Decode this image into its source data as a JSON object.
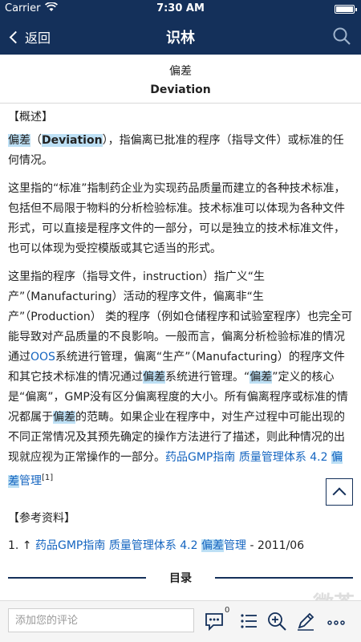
{
  "status": {
    "carrier": "Carrier",
    "time": "7:30 AM"
  },
  "nav": {
    "back_label": "返回",
    "title": "识林"
  },
  "article": {
    "title": "偏差",
    "subtitle": "Deviation",
    "overview_head": "【概述】",
    "p1": {
      "t1": "偏差",
      "t2": "（",
      "t3": "Deviation",
      "t4": "），指偏离已批准的程序（指导文件）或标准的任何情况。"
    },
    "p2": "这里指的“标准”指制药企业为实现药品质量而建立的各种技术标准，包括但不局限于物料的分析检验标准。技术标准可以体现为各种文件形式，可以直接是程序文件的一部分，可以是独立的技术标准文件，也可以体现为受控模版或其它适当的形式。",
    "p3": {
      "s1": "这里指的程序（指导文件，instruction）指广义“生产”（Manufacturing）活动的程序文件，偏离非“生产”（Production） 类的程序（例如仓储程序和试验室程序）也完全可能导致对产品质量的不良影响。一般而言，偏离分析检验标准的情况通过",
      "oos": "OOS",
      "s2": "系统进行管理，偏离“生产”（Manufacturing）的程序文件和其它技术标准的情况通过",
      "hl1": "偏差",
      "s3": "系统进行管理。“",
      "hl2": "偏差",
      "s4": "”定义的核心是“偏离”，GMP没有区分偏离程度的大小。所有偏离程序或标准的情况都属于",
      "hl3": "偏差",
      "s5": "的范畴。如果企业在程序中，对生产过程中可能出现的不同正常情况及其预先确定的操作方法进行了描述，则此种情况的出现就应视为正常操作的一部分。",
      "link_a": "药品GMP指南 质量管理体系 4.2 ",
      "link_hl": "偏差",
      "link_b": "管理",
      "sup": "[1]"
    },
    "refs_head": "【参考资料】",
    "ref1": {
      "num": "1. ↑ ",
      "link_a": "药品GMP指南 质量管理体系 4.2 ",
      "link_hl": "偏差",
      "link_b": "管理",
      "date": " - 2011/06"
    }
  },
  "toc": {
    "label": "目录"
  },
  "bottom": {
    "comment_placeholder": "添加您的评论",
    "comment_count": "0"
  },
  "watermark": {
    "main": "微茶",
    "sub": "WXCHA"
  },
  "colors": {
    "primary": "#14305a",
    "highlight": "#bde0f5",
    "link": "#1565c0"
  }
}
